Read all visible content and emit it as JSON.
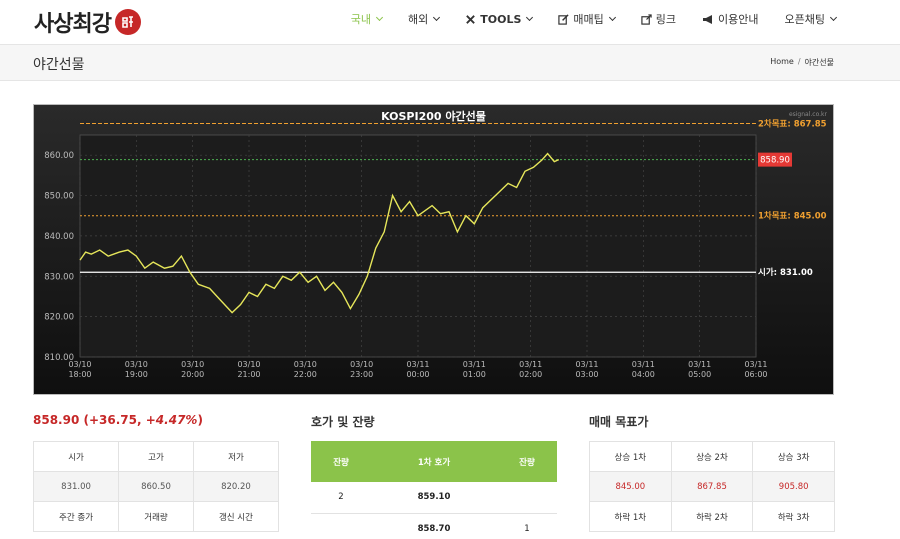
{
  "header": {
    "logo_text": "사상최강",
    "nav": [
      {
        "label": "국내",
        "icon": "",
        "dropdown": true,
        "active": true
      },
      {
        "label": "해외",
        "icon": "",
        "dropdown": true,
        "active": false
      },
      {
        "label": "TOOLS",
        "icon": "tools-icon",
        "dropdown": true,
        "active": false
      },
      {
        "label": "매매팁",
        "icon": "edit-icon",
        "dropdown": true,
        "active": false
      },
      {
        "label": "링크",
        "icon": "external-link-icon",
        "dropdown": false,
        "active": false
      },
      {
        "label": "이용안내",
        "icon": "bullhorn-icon",
        "dropdown": false,
        "active": false
      },
      {
        "label": "오픈채팅",
        "icon": "",
        "dropdown": true,
        "active": false
      }
    ],
    "accent_color": "#8bc34a"
  },
  "titlebar": {
    "title": "야간선물",
    "breadcrumb": [
      "Home",
      "야간선물"
    ],
    "breadcrumb_sep": "/"
  },
  "chart_data": {
    "type": "line",
    "title": "KOSPI200 야간선물",
    "watermark": "esignal.co.kr",
    "ylim": [
      810,
      865
    ],
    "yticks": [
      "810.00",
      "820.00",
      "830.00",
      "840.00",
      "850.00",
      "860.00"
    ],
    "xlim_hours": [
      0,
      12
    ],
    "xticks": [
      [
        "03/10",
        "18:00"
      ],
      [
        "03/10",
        "19:00"
      ],
      [
        "03/10",
        "20:00"
      ],
      [
        "03/10",
        "21:00"
      ],
      [
        "03/10",
        "22:00"
      ],
      [
        "03/10",
        "23:00"
      ],
      [
        "03/11",
        "00:00"
      ],
      [
        "03/11",
        "01:00"
      ],
      [
        "03/11",
        "02:00"
      ],
      [
        "03/11",
        "03:00"
      ],
      [
        "03/11",
        "04:00"
      ],
      [
        "03/11",
        "05:00"
      ],
      [
        "03/11",
        "06:00"
      ]
    ],
    "grid": true,
    "series": [
      {
        "color": "#e6e65a",
        "x": [
          0,
          0.1,
          0.2,
          0.35,
          0.5,
          0.7,
          0.85,
          1.0,
          1.15,
          1.3,
          1.5,
          1.65,
          1.8,
          1.95,
          2.1,
          2.3,
          2.5,
          2.7,
          2.85,
          3.0,
          3.15,
          3.3,
          3.45,
          3.6,
          3.75,
          3.9,
          4.05,
          4.2,
          4.35,
          4.5,
          4.65,
          4.8,
          4.95,
          5.1,
          5.25,
          5.4,
          5.55,
          5.7,
          5.85,
          6.0,
          6.1,
          6.25,
          6.4,
          6.55,
          6.7,
          6.85,
          7.0,
          7.15,
          7.3,
          7.45,
          7.6,
          7.75,
          7.9,
          8.05,
          8.2,
          8.3,
          8.42,
          8.5
        ],
        "y": [
          834,
          836,
          835.5,
          836.5,
          835,
          836,
          836.5,
          835,
          832,
          833.5,
          832,
          832.5,
          835,
          831,
          828,
          827,
          824,
          821,
          823,
          826,
          825,
          828,
          827,
          830,
          829,
          831,
          828.5,
          830,
          826.5,
          828.5,
          826,
          822,
          825.5,
          830,
          837,
          841,
          850,
          846,
          848.5,
          845,
          846,
          847.5,
          845.5,
          846,
          841,
          845,
          843,
          847,
          849,
          851,
          853,
          852,
          856,
          857,
          858.8,
          860.4,
          858.4,
          858.9
        ]
      }
    ],
    "hlines": [
      {
        "label": "2차목표: 867.85",
        "value": 867.85,
        "color": "#f0a030",
        "style": "dashed"
      },
      {
        "label": "858.90",
        "value": 858.9,
        "color": "#4caf50",
        "style": "dotted",
        "badge_color": "#e53935"
      },
      {
        "label": "1차목표: 845.00",
        "value": 845.0,
        "color": "#f0a030",
        "style": "dotted"
      },
      {
        "label": "시가: 831.00",
        "value": 831.0,
        "color": "#ffffff",
        "style": "solid"
      }
    ]
  },
  "quote": {
    "price": "858.90",
    "change": "+36.75,",
    "pct": "+4.47%",
    "table": {
      "headers": [
        "시가",
        "고가",
        "저가"
      ],
      "values": [
        "831.00",
        "860.50",
        "820.20"
      ],
      "headers2": [
        "주간 종가",
        "거래량",
        "갱신 시간"
      ]
    }
  },
  "orderbook": {
    "title": "호가 및 잔량",
    "headers": [
      "잔량",
      "1차 호가",
      "잔량"
    ],
    "rows": [
      [
        "2",
        "859.10",
        ""
      ],
      [
        "",
        "858.70",
        "1"
      ]
    ]
  },
  "targets": {
    "title": "매매 목표가",
    "headers": [
      "상승 1차",
      "상승 2차",
      "상승 3차"
    ],
    "values": [
      "845.00",
      "867.85",
      "905.80"
    ],
    "headers2": [
      "하락 1차",
      "하락 2차",
      "하락 3차"
    ]
  }
}
